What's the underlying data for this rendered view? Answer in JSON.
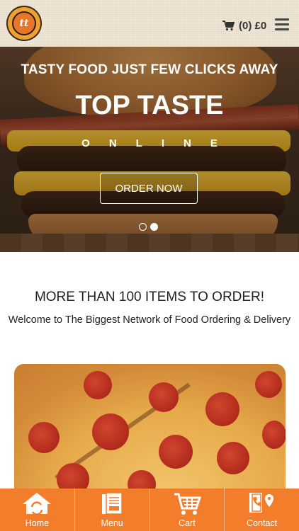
{
  "header": {
    "logo_text": "tt",
    "cart_summary": "(0) £0",
    "icons": [
      "cart-icon",
      "hamburger-menu-icon"
    ]
  },
  "hero": {
    "tagline": "TASTY FOOD JUST FEW CLICKS AWAY",
    "title": "TOP TASTE",
    "subtitle": "ONLINE",
    "cta_label": "ORDER NOW",
    "slides": {
      "count": 2,
      "active_index": 1
    }
  },
  "intro": {
    "heading": "MORE THAN 100 ITEMS TO ORDER!",
    "text": "Welcome to The Biggest Network of Food Ordering & Delivery"
  },
  "bottom_nav": {
    "accent_color": "#f27e2b",
    "items": [
      {
        "label": "Home",
        "icon": "home-icon"
      },
      {
        "label": "Menu",
        "icon": "menu-book-icon"
      },
      {
        "label": "Cart",
        "icon": "cart-icon"
      },
      {
        "label": "Contact",
        "icon": "contact-icon"
      }
    ]
  }
}
